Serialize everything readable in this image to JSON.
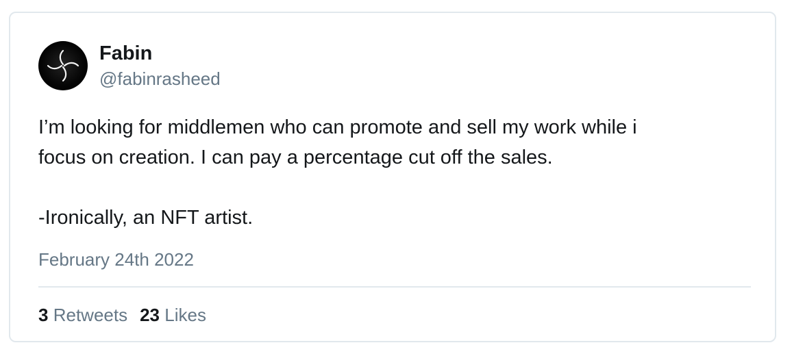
{
  "author": {
    "name": "Fabin",
    "handle": "@fabinrasheed",
    "avatar_icon": "swirl-cross-avatar"
  },
  "tweet": {
    "text": "I’m looking for middlemen who can promote and sell my work while i\nfocus on creation. I can pay a percentage cut off the sales.\n\n-Ironically, an NFT artist.",
    "date": "February 24th 2022"
  },
  "stats": {
    "retweets_count": "3",
    "retweets_label": "Retweets",
    "likes_count": "23",
    "likes_label": "Likes"
  },
  "colors": {
    "text": "#14171a",
    "secondary_text": "#657786",
    "border": "#e1e8ed",
    "background": "#ffffff"
  }
}
